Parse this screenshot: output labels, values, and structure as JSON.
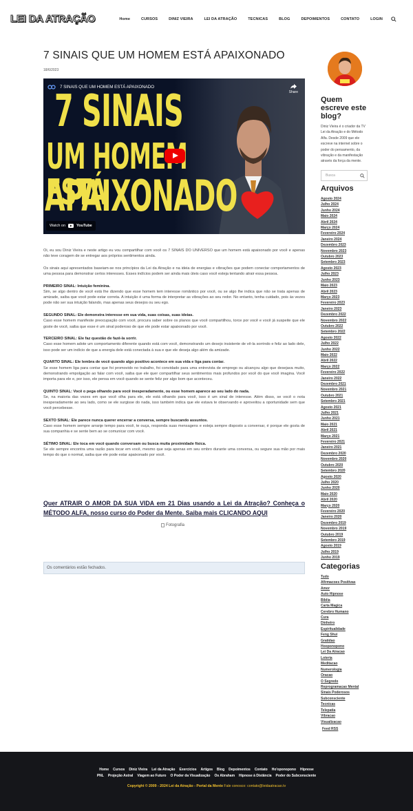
{
  "header": {
    "logo": "LEI DA ATRAÇÃO",
    "nav": [
      "Home",
      "CURSOS",
      "DINIZ VIEIRA",
      "LEI DA ATRAÇÃO",
      "TECNICAS",
      "BLOG",
      "DEPOIMENTOS",
      "CONTATO",
      "LOGIN"
    ],
    "search_icon": "search-icon"
  },
  "post": {
    "title": "7 SINAIS QUE UM HOMEM ESTÁ APAIXONADO",
    "date": "18/6/2023",
    "video": {
      "heading": "7 SINAIS QUE UM HOMEM ESTÁ APAIXONADO",
      "share": "Share",
      "line1": "7 SINAIS",
      "line2": "UM HOMEM ESTÁ",
      "line3": "APAIXONADO",
      "watch_on": "Watch on",
      "youtube": "YouTube"
    },
    "intro1": "Oi, eu sou Diniz Vieira e neste artigo eu vou compartilhar com você os 7 SINAIS DO UNIVERSO que um homem está apaixonado por você e apenas não teve coragem de se entregar aos próprios sentimentos ainda.",
    "intro2": "Os sinais aqui apresentados baseiam-se nos princípios da Lei da Atração e na ideia de energias e vibrações que podem conectar comportamentos de uma pessoa para demonstrar certos interesses. Esses indícios podem ser ainda mais úteis caso você esteja tentando atrair essa pessoa.",
    "signs": [
      {
        "h": "PRIMEIRO SINAL: Intuição feminina.",
        "t": "Sim, se algo dentro de você está lhe dizendo que esse homem tem interesse romântico por você, ou se algo lhe indica que não se trata apenas de amizade, saiba que você pode estar correta. A intuição é uma forma de interpretar as vibrações ao seu redor. No entanto, tenha cuidado, pois às vezes pode não ser sua intuição falando, mas apenas seus desejos ou seu ego."
      },
      {
        "h": "SEGUNDO SINAL: Ele demonstra interesse em sua vida, suas coisas, suas ideias.",
        "t": "Caso esse homem manifeste preocupação com você, procura saber sobre os planos que você compartilhou, torce por você e você já suspeite que ele goste de você, saiba que esse é um sinal poderoso de que ele pode estar apaixonado por você."
      },
      {
        "h": "TERCEIRO SINAL: Ele faz questão de fazê-la sorrir.",
        "t": "Caso esse homem adote um comportamento diferente quando está com você, demonstrando um desejo insistente de vê-la sorrindo e feliz ao lado dele, isso pode ser um indício de que a energia dele está conectada à sua e que ele deseja algo além da amizade."
      },
      {
        "h": "QUARTO SINAL: Ele lembra de você quando algo positivo acontece em sua vida e liga para contar.",
        "t": "Se esse homem liga para contar que foi promovido no trabalho, foi convidado para uma entrevista de emprego ou alcançou algo que desejava muito, demonstrando empolgação ao falar com você, saiba que ele quer compartilhar seus sentimentos mais profundos por você do que você imagina. Você importa para ele e, por isso, ele pensa em você quando se sente feliz por algo bom que aconteceu."
      },
      {
        "h": "QUINTO SINAL: Você o pega olhando para você inesperadamente, ou esse homem aparece ao seu lado do nada.",
        "t": "Se, na maioria das vezes em que você olha para ele, ele está olhando para você, isso é um sinal de interesse. Além disso, se você o nota inesperadamente ao seu lado, como se ele surgisse do nada, isso também indica que ele estava te observando e aproveitou a oportunidade sem que você percebesse."
      },
      {
        "h": "SEXTO SINAL: Ele parece nunca querer encerrar a conversa, sempre buscando assuntos.",
        "t": "Caso esse homem sempre arranje tempo para você, te ouça, responda suas mensagens e esteja sempre disposto a conversar, é porque ele gosta de sua companhia e se sente bem ao se comunicar com você."
      },
      {
        "h": "SÉTIMO SINAL: Ele toca em você quando conversam ou busca muita proximidade física.",
        "t": "Se ele sempre encontra uma razão para tocar em você, mesmo que seja apenas em seu ombro durante uma conversa, ou segure sua mão por mais tempo do que o normal, saiba que ele pode estar apaixonado por você."
      }
    ],
    "cta": "Quer ATRAIR O AMOR DA SUA VIDA em 21 Dias usando a Lei da Atração? Conheça o MÉTODO ALFA, nosso curso do Poder da Mente. Saiba mais CLICANDO AQUI",
    "image_alt": "Fotografia",
    "comments_closed": "Os comentários estão fechados."
  },
  "sidebar": {
    "who_title": "Quem escreve este blog?",
    "bio": "Diniz Vieira é o criador da TV Lei da Atração e do Método Alfa. Desde 2009 que ele escreve na internet sobre o poder do pensamento, da vibração e da manifestação através da força da mente.",
    "search_placeholder": "Busca",
    "archives_title": "Arquivos",
    "archives": [
      "Agosto 2024",
      "Julho 2024",
      "Junho 2024",
      "Maio 2024",
      "Abril 2024",
      "Março 2024",
      "Fevereiro 2024",
      "Janeiro 2024",
      "Dezembro 2023",
      "Novembro 2023",
      "Outubro 2023",
      "Setembro 2023",
      "Agosto 2023",
      "Julho 2023",
      "Junho 2023",
      "Maio 2023",
      "Abril 2023",
      "Março 2023",
      "Fevereiro 2023",
      "Janeiro 2023",
      "Dezembro 2022",
      "Novembro 2022",
      "Outubro 2022",
      "Setembro 2022",
      "Agosto 2022",
      "Julho 2022",
      "Junho 2022",
      "Maio 2022",
      "Abril 2022",
      "Março 2022",
      "Fevereiro 2022",
      "Janeiro 2022",
      "Dezembro 2021",
      "Novembro 2021",
      "Outubro 2021",
      "Setembro 2021",
      "Agosto 2021",
      "Julho 2021",
      "Junho 2021",
      "Maio 2021",
      "Abril 2021",
      "Março 2021",
      "Fevereiro 2021",
      "Janeiro 2021",
      "Dezembro 2020",
      "Novembro 2020",
      "Outubro 2020",
      "Setembro 2020",
      "Agosto 2020",
      "Julho 2020",
      "Junho 2020",
      "Maio 2020",
      "Abril 2020",
      "Março 2020",
      "Fevereiro 2020",
      "Janeiro 2020",
      "Dezembro 2019",
      "Novembro 2019",
      "Outubro 2019",
      "Setembro 2019",
      "Agosto 2019",
      "Julho 2019",
      "Junho 2019"
    ],
    "categories_title": "Categorias",
    "categories": [
      "Tudo",
      "Afirmacoes Positivas",
      "Amor",
      "Auto Hipnose",
      "Biblia",
      "Carta Magica",
      "Cerebro Humano",
      "Cura",
      "Dinheiro",
      "Espiritualidade",
      "Feng Shui",
      "Gratidao",
      "Hooponopono",
      "Lei Da Atracao",
      "Loteria",
      "Meditacao",
      "Numerologia",
      "Oracao",
      "O Segredo",
      "Reprogramacao Mental",
      "Sinais Poderosos",
      "Subconsciente",
      "Tecnicas",
      "Telepatia",
      "Vibracao",
      "Visualizacao"
    ],
    "rss": "Feed RSS"
  },
  "footer": {
    "row1": [
      "Home",
      "Cursos",
      "Diniz Vieira",
      "Lei da Atração",
      "Exercícios",
      "Artigos",
      "Blog",
      "Depoimentos",
      "Contato",
      "Ho'oponopono",
      "Hipnose"
    ],
    "row2": [
      "PNL",
      "Projeção Astral",
      "Viagem ao Futuro",
      "O Poder da Visualização",
      "Os Abraham",
      "Hipnose à Distância",
      "Poder do Subconsciente"
    ],
    "copyright": "Copyright © 2009 - 2024 Lei da Atração - Portal da Mente",
    "contact": "Fale conosco: contato@leidaatracao.tv"
  },
  "colors": {
    "accent": "#f2c12e",
    "footer_bg": "#15161a",
    "video_text": "#f0e04a",
    "play": "#ee0000"
  }
}
